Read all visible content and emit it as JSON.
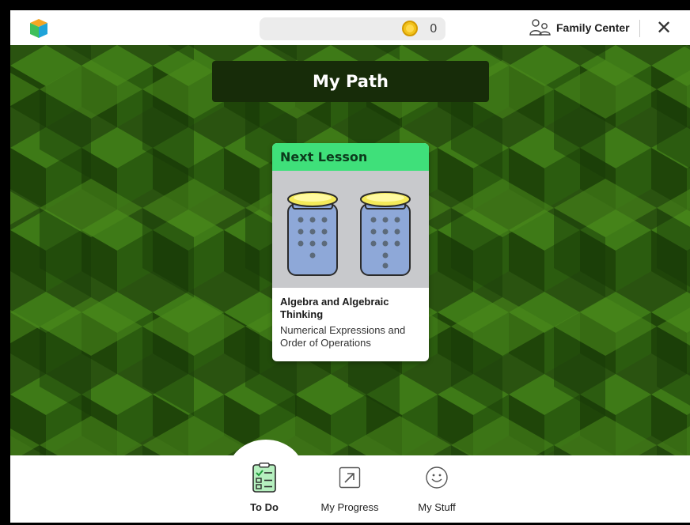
{
  "header": {
    "coin_count": "0",
    "family_center_label": "Family Center",
    "close_label": "✕",
    "icons": {
      "logo": "cube-logo-icon",
      "coin": "coin-icon",
      "family": "people-icon",
      "close": "close-icon"
    }
  },
  "main": {
    "title": "My Path",
    "next_lesson": {
      "header": "Next Lesson",
      "title": "Algebra and Algebraic Thinking",
      "subtitle": "Numerical Expressions and Order of Operations",
      "image": "two-jars-of-bugs-illustration"
    }
  },
  "bottom_nav": {
    "items": [
      {
        "label": "To Do",
        "icon": "checklist-icon",
        "active": true
      },
      {
        "label": "My Progress",
        "icon": "progress-arrow-icon",
        "active": false
      },
      {
        "label": "My Stuff",
        "icon": "smiley-icon",
        "active": false
      }
    ]
  },
  "colors": {
    "lesson_header": "#3fe07a",
    "title_bar": "#172c09",
    "background_green": "#2f5a12",
    "coin": "#f1c21b"
  }
}
